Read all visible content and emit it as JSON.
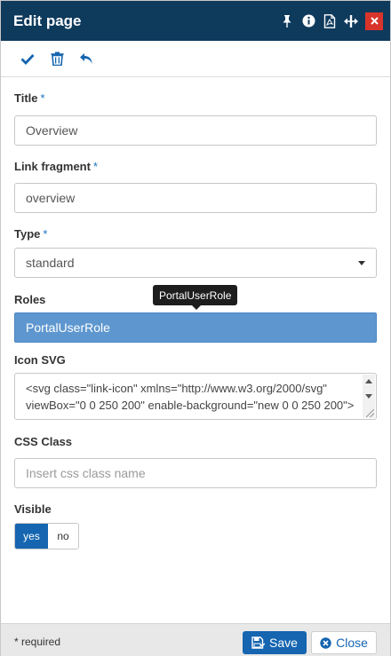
{
  "header": {
    "title": "Edit page",
    "icons": [
      "pin-icon",
      "info-icon",
      "pdf-icon",
      "resize-width-icon",
      "close-icon"
    ]
  },
  "toolbar": {
    "icons": [
      "check-icon",
      "trash-icon",
      "undo-icon"
    ]
  },
  "form": {
    "title": {
      "label": "Title",
      "required_mark": "*",
      "value": "Overview"
    },
    "link_fragment": {
      "label": "Link fragment",
      "required_mark": "*",
      "value": "overview"
    },
    "type": {
      "label": "Type",
      "required_mark": "*",
      "value": "standard"
    },
    "roles": {
      "label": "Roles",
      "selected": "PortalUserRole",
      "tooltip": "PortalUserRole"
    },
    "icon_svg": {
      "label": "Icon SVG",
      "value": "<svg class=\"link-icon\" xmlns=\"http://www.w3.org/2000/svg\" viewBox=\"0 0 250 200\" enable-background=\"new 0 0 250 200\">"
    },
    "css_class": {
      "label": "CSS Class",
      "placeholder": "Insert css class name"
    },
    "visible": {
      "label": "Visible",
      "yes": "yes",
      "no": "no",
      "value": "yes"
    }
  },
  "footer": {
    "required_note": "* required",
    "save_label": "Save",
    "close_label": "Close"
  },
  "colors": {
    "header_bg": "#0e3a5c",
    "accent": "#1565b0",
    "chip": "#5e97cf",
    "close_red": "#d9342b"
  }
}
